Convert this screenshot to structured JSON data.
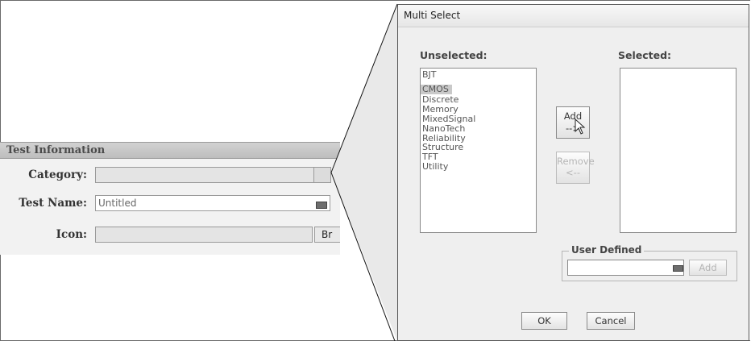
{
  "test_info": {
    "header": "Test Information",
    "category_label": "Category:",
    "category_value": "",
    "test_name_label": "Test Name:",
    "test_name_value": "Untitled",
    "icon_label": "Icon:",
    "icon_value": "",
    "browse_label": "Br"
  },
  "dialog": {
    "title": "Multi Select",
    "unselected_label": "Unselected:",
    "selected_label": "Selected:",
    "unselected_items": [
      "BJT",
      "CMOS",
      "Discrete",
      "Memory",
      "MixedSignal",
      "NanoTech",
      "Reliability",
      "Structure",
      "TFT",
      "Utility"
    ],
    "highlighted_item": "CMOS",
    "selected_items": [],
    "add_label_line1": "Add",
    "add_label_line2": "-->",
    "remove_label_line1": "Remove",
    "remove_label_line2": "<--",
    "user_defined_label": "User Defined",
    "user_defined_value": "",
    "user_defined_add": "Add",
    "ok_label": "OK",
    "cancel_label": "Cancel"
  },
  "icons": {
    "keyboard": "keyboard-icon",
    "cursor": "mouse-pointer-icon"
  }
}
